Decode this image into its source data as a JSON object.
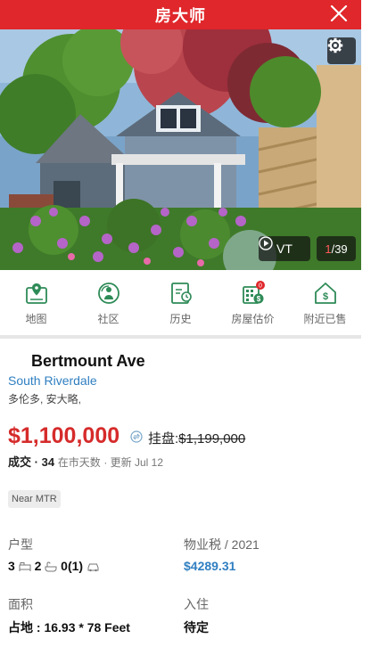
{
  "header": {
    "title": "房大师"
  },
  "photo": {
    "vt_label": "VT",
    "current": "1",
    "total": "/39"
  },
  "nav": [
    {
      "label": "地图",
      "icon": "map-pin-icon"
    },
    {
      "label": "社区",
      "icon": "community-icon"
    },
    {
      "label": "历史",
      "icon": "history-icon"
    },
    {
      "label": "房屋估价",
      "icon": "valuation-icon",
      "badge": "0"
    },
    {
      "label": "附近已售",
      "icon": "nearby-sold-icon"
    }
  ],
  "listing": {
    "address": "Bertmount Ave",
    "neighbourhood": "South Riverdale",
    "city": "多伦多, 安大略,",
    "price": "$1,100,000",
    "asking_label": "挂盘:",
    "asking_price": "$1,199,000",
    "status_label": "成交",
    "status_sep": "·",
    "days": "34",
    "days_label": "在市天数",
    "updated": "· 更新 Jul 12",
    "tag": "Near MTR"
  },
  "details": {
    "type_label": "户型",
    "bedrooms": "3",
    "bathrooms": "2",
    "parking": "0(1)",
    "tax_label": "物业税 / 2021",
    "tax_value": "$4289.31",
    "area_label": "面积",
    "lot_value": "占地 : 16.93 * 78 Feet",
    "occupancy_label": "入住",
    "occupancy_value": "待定"
  },
  "colors": {
    "brand_red": "#e0272b",
    "price_red": "#d62b2b",
    "link_blue": "#2f7fc1",
    "icon_green": "#2e8b57"
  }
}
